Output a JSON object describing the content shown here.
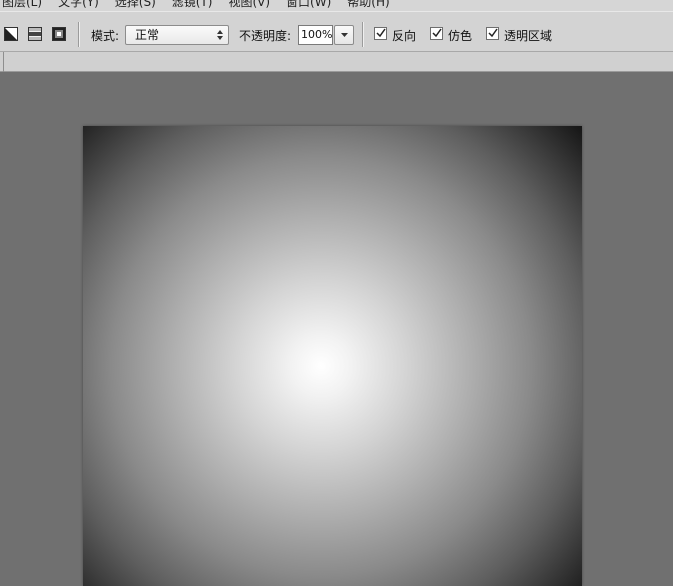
{
  "menubar": {
    "items": [
      "图层(L)",
      "文字(Y)",
      "选择(S)",
      "滤镜(T)",
      "视图(V)",
      "窗口(W)",
      "帮助(H)"
    ]
  },
  "options": {
    "mode_label": "模式:",
    "mode_value": "正常",
    "opacity_label": "不透明度:",
    "opacity_value": "100%",
    "reverse_label": "反向",
    "dither_label": "仿色",
    "transparency_label": "透明区域",
    "reverse_checked": true,
    "dither_checked": true,
    "transparency_checked": true
  },
  "gradient_tools": [
    "diamond-gradient-icon",
    "reflected-gradient-icon",
    "radial-square-gradient-icon"
  ],
  "canvas": {
    "gradient_type": "radial",
    "center_color": "#ffffff",
    "edge_color": "#000000"
  },
  "colors": {
    "workspace": "#707070",
    "toolbar": "#d3d3d3"
  }
}
